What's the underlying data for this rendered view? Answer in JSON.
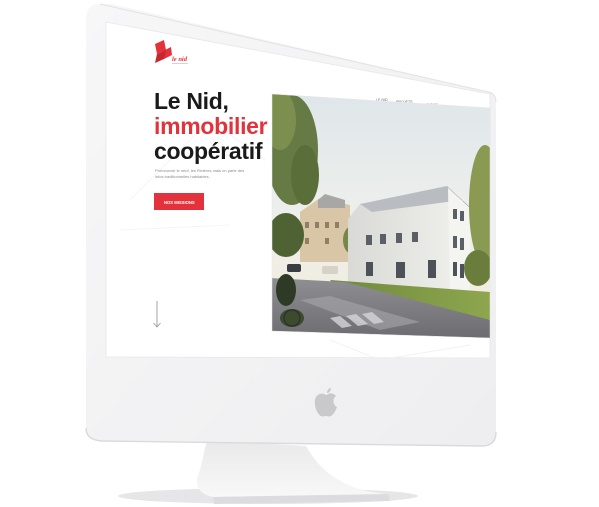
{
  "brand": {
    "logo_text": "le nid",
    "accent": "#e3323b"
  },
  "nav": {
    "items": [
      "LE NID",
      "PROJETS",
      "BOUTIQUE",
      "CONTACT"
    ]
  },
  "hero": {
    "line1": "Le Nid,",
    "line2": "immobilier",
    "line3": "coopératif",
    "text_line1": "Promouvoir le neuf, les Rivières mais on parle des",
    "text_line2": "infos traditionnelles habitables.",
    "button": "NOS MISSIONS"
  },
  "icons": {
    "scroll": "arrow-down-icon",
    "device": "apple-logo-icon"
  },
  "colors": {
    "accent": "#e3323b",
    "text": "#1a1a1a",
    "bezel": "#f2f2f3"
  }
}
